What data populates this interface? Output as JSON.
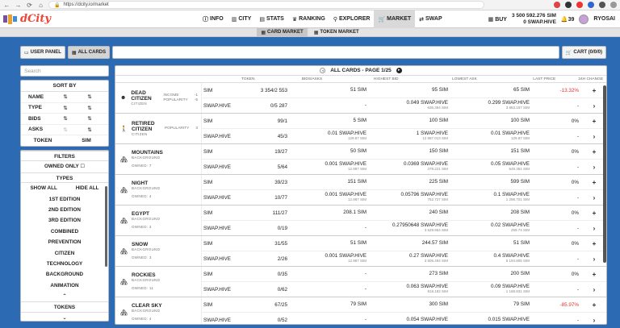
{
  "browser": {
    "url": "https://dcity.io/market"
  },
  "brand": {
    "name": "dCity"
  },
  "nav": {
    "items": [
      {
        "label": "INFO",
        "icon": "info"
      },
      {
        "label": "CITY",
        "icon": "building"
      },
      {
        "label": "STATS",
        "icon": "chart"
      },
      {
        "label": "RANKING",
        "icon": "trophy"
      },
      {
        "label": "EXPLORER",
        "icon": "search"
      },
      {
        "label": "MARKET",
        "icon": "cart"
      },
      {
        "label": "SWAP",
        "icon": "swap"
      }
    ],
    "active": "MARKET"
  },
  "wallet": {
    "buy": "BUY",
    "sim": "3 500 592.276 SIM",
    "swap_hive": "0 SWAP.HIVE",
    "notifications": "39",
    "user": "RYOSAI"
  },
  "subnav": {
    "tabs": [
      "CARD MARKET",
      "TOKEN MARKET"
    ]
  },
  "toolbar": {
    "user_panel": "USER PANEL",
    "all_cards": "ALL CARDS",
    "cart": "CART (0/0/0)"
  },
  "sidebar": {
    "search_placeholder": "Search",
    "sort_by": "SORT BY",
    "sort_rows": [
      "NAME",
      "TYPE",
      "BIDS",
      "ASKS"
    ],
    "token": "TOKEN",
    "token_val": "SIM",
    "filters": "FILTERS",
    "owned_only": "OWNED ONLY",
    "types": "TYPES",
    "show_all": "SHOW ALL",
    "hide_all": "HIDE ALL",
    "editions": [
      "1ST EDITION",
      "2ND EDITION",
      "3RD EDITION",
      "COMBINED",
      "PREVENTION",
      "CITIZEN",
      "TECHNOLOGY",
      "BACKGROUND",
      "ANIMATION"
    ],
    "tokens": "TOKENS"
  },
  "main": {
    "page_label": "ALL CARDS - PAGE 1/25",
    "columns": [
      "TOKEN",
      "BIDS/ASKS",
      "HIGHEST BID",
      "LOWEST ASK",
      "LAST PRICE",
      "24H CHANGE"
    ]
  },
  "cards": [
    {
      "name": "DEAD CITIZEN",
      "type": "CITIZEN",
      "icon": "☻",
      "stats": [
        [
          "INCOME",
          "-1"
        ],
        [
          "POPULARITY",
          "-5"
        ]
      ],
      "owned": "",
      "rows": [
        {
          "token": "SIM",
          "bids": "3 354/2 553",
          "hb": "51 SIM",
          "hb2": "",
          "la": "95 SIM",
          "la2": "",
          "lp": "65 SIM",
          "lp2": "",
          "chg": "-13.32%",
          "neg": true
        },
        {
          "token": "SWAP.HIVE",
          "bids": "0/5 287",
          "hb": "-",
          "hb2": "",
          "la": "0.049 SWAP.HIVE",
          "la2": "636.364 SIM",
          "lp": "0.299 SWAP.HIVE",
          "lp2": "3 883.157 SIM",
          "chg": "-",
          "neg": false
        }
      ]
    },
    {
      "name": "RETIRED CITIZEN",
      "type": "CITIZEN",
      "icon": "🚶",
      "stats": [
        [
          "POPULARITY",
          "3"
        ]
      ],
      "owned": "",
      "rows": [
        {
          "token": "SIM",
          "bids": "99/1",
          "hb": "5 SIM",
          "hb2": "",
          "la": "100 SIM",
          "la2": "",
          "lp": "100 SIM",
          "lp2": "",
          "chg": "0%",
          "neg": false
        },
        {
          "token": "SWAP.HIVE",
          "bids": "45/3",
          "hb": "0.01 SWAP.HIVE",
          "hb2": "129.87 SIM",
          "la": "1 SWAP.HIVE",
          "la2": "12 987.013 SIM",
          "lp": "0.01 SWAP.HIVE",
          "lp2": "129.87 SIM",
          "chg": "-",
          "neg": false
        }
      ]
    },
    {
      "name": "MOUNTAINS",
      "type": "BACKGROUND",
      "icon": "🏘",
      "stats": [],
      "owned": "OWNED: 7",
      "rows": [
        {
          "token": "SIM",
          "bids": "19/27",
          "hb": "50 SIM",
          "hb2": "",
          "la": "150 SIM",
          "la2": "",
          "lp": "151 SIM",
          "lp2": "",
          "chg": "0%",
          "neg": false
        },
        {
          "token": "SWAP.HIVE",
          "bids": "5/64",
          "hb": "0.001 SWAP.HIVE",
          "hb2": "12.987 SIM",
          "la": "0.0369 SWAP.HIVE",
          "la2": "479.221 SIM",
          "lp": "0.05 SWAP.HIVE",
          "lp2": "649.351 SIM",
          "chg": "-",
          "neg": false
        }
      ]
    },
    {
      "name": "NIGHT",
      "type": "BACKGROUND",
      "icon": "🏘",
      "stats": [],
      "owned": "OWNED: 4",
      "rows": [
        {
          "token": "SIM",
          "bids": "39/23",
          "hb": "151 SIM",
          "hb2": "",
          "la": "225 SIM",
          "la2": "",
          "lp": "599 SIM",
          "lp2": "",
          "chg": "0%",
          "neg": false
        },
        {
          "token": "SWAP.HIVE",
          "bids": "10/77",
          "hb": "0.001 SWAP.HIVE",
          "hb2": "12.987 SIM",
          "la": "0.05796 SWAP.HIVE",
          "la2": "752.727 SIM",
          "lp": "0.1 SWAP.HIVE",
          "lp2": "1 298.701 SIM",
          "chg": "-",
          "neg": false
        }
      ]
    },
    {
      "name": "EGYPT",
      "type": "BACKGROUND",
      "icon": "🏘",
      "stats": [],
      "owned": "OWNED: 3",
      "rows": [
        {
          "token": "SIM",
          "bids": "111/27",
          "hb": "208.1 SIM",
          "hb2": "",
          "la": "240 SIM",
          "la2": "",
          "lp": "208 SIM",
          "lp2": "",
          "chg": "0%",
          "neg": false
        },
        {
          "token": "SWAP.HIVE",
          "bids": "0/19",
          "hb": "-",
          "hb2": "",
          "la": "0.27950648 SWAP.HIVE",
          "la2": "3 629.954 SIM",
          "lp": "0.02 SWAP.HIVE",
          "lp2": "259.74 SIM",
          "chg": "-",
          "neg": false
        }
      ]
    },
    {
      "name": "SNOW",
      "type": "BACKGROUND",
      "icon": "🏘",
      "stats": [],
      "owned": "OWNED: 3",
      "rows": [
        {
          "token": "SIM",
          "bids": "31/55",
          "hb": "51 SIM",
          "hb2": "",
          "la": "244.57 SIM",
          "la2": "",
          "lp": "51 SIM",
          "lp2": "",
          "chg": "0%",
          "neg": false
        },
        {
          "token": "SWAP.HIVE",
          "bids": "2/26",
          "hb": "0.001 SWAP.HIVE",
          "hb2": "12.987 SIM",
          "la": "0.27 SWAP.HIVE",
          "la2": "3 506.494 SIM",
          "lp": "0.4 SWAP.HIVE",
          "lp2": "5 194.805 SIM",
          "chg": "-",
          "neg": false
        }
      ]
    },
    {
      "name": "ROCKIES",
      "type": "BACKGROUND",
      "icon": "🏘",
      "stats": [],
      "owned": "OWNED: 11",
      "rows": [
        {
          "token": "SIM",
          "bids": "0/35",
          "hb": "-",
          "hb2": "",
          "la": "273 SIM",
          "la2": "",
          "lp": "200 SIM",
          "lp2": "",
          "chg": "0%",
          "neg": false
        },
        {
          "token": "SWAP.HIVE",
          "bids": "0/62",
          "hb": "-",
          "hb2": "",
          "la": "0.063 SWAP.HIVE",
          "la2": "818.182 SIM",
          "lp": "0.09 SWAP.HIVE",
          "lp2": "1 168.831 SIM",
          "chg": "-",
          "neg": false
        }
      ]
    },
    {
      "name": "CLEAR SKY",
      "type": "BACKGROUND",
      "icon": "🏘",
      "stats": [],
      "owned": "OWNED: 4",
      "rows": [
        {
          "token": "SIM",
          "bids": "67/25",
          "hb": "79 SIM",
          "hb2": "",
          "la": "300 SIM",
          "la2": "",
          "lp": "79 SIM",
          "lp2": "",
          "chg": "-85.97%",
          "neg": true
        },
        {
          "token": "SWAP.HIVE",
          "bids": "0/52",
          "hb": "-",
          "hb2": "",
          "la": "0.054 SWAP.HIVE",
          "la2": "",
          "lp": "0.015 SWAP.HIVE",
          "lp2": "",
          "chg": "-",
          "neg": false
        }
      ]
    }
  ]
}
